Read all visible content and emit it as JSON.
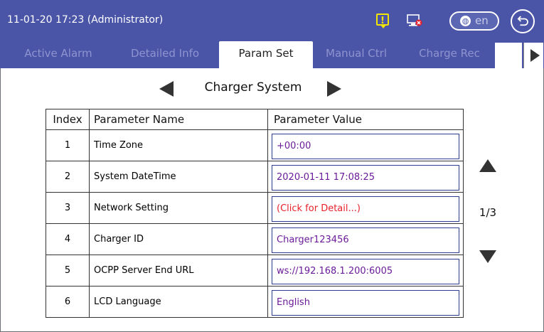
{
  "header": {
    "datetime": "11-01-20  17:23 (Administrator)",
    "alert_symbol": "!",
    "language": "en",
    "icons": [
      "alert-icon",
      "monitor-offline-icon",
      "globe-icon",
      "back-arrow-icon"
    ],
    "colors": {
      "bar": "#4a55a8",
      "alert": "#f2e600",
      "offline": "#e8202a"
    }
  },
  "tabs": [
    {
      "label": "Active Alarm",
      "active": false
    },
    {
      "label": "Detailed Info",
      "active": false
    },
    {
      "label": "Param Set",
      "active": true
    },
    {
      "label": "Manual Ctrl",
      "active": false
    },
    {
      "label": "Charge Rec",
      "active": false
    }
  ],
  "section": {
    "title": "Charger System"
  },
  "table": {
    "headers": [
      "Index",
      "Parameter Name",
      "Parameter Value"
    ],
    "rows": [
      {
        "index": "1",
        "name": "Time Zone",
        "value": "+00:00"
      },
      {
        "index": "2",
        "name": "System DateTime",
        "value": "2020-01-11 17:08:25"
      },
      {
        "index": "3",
        "name": "Network Setting",
        "value": "(Click for Detail...)"
      },
      {
        "index": "4",
        "name": "Charger ID",
        "value": "Charger123456"
      },
      {
        "index": "5",
        "name": "OCPP Server End URL",
        "value": "ws://192.168.1.200:6005"
      },
      {
        "index": "6",
        "name": "LCD Language",
        "value": "English"
      }
    ]
  },
  "pager": {
    "label": "1/3"
  }
}
